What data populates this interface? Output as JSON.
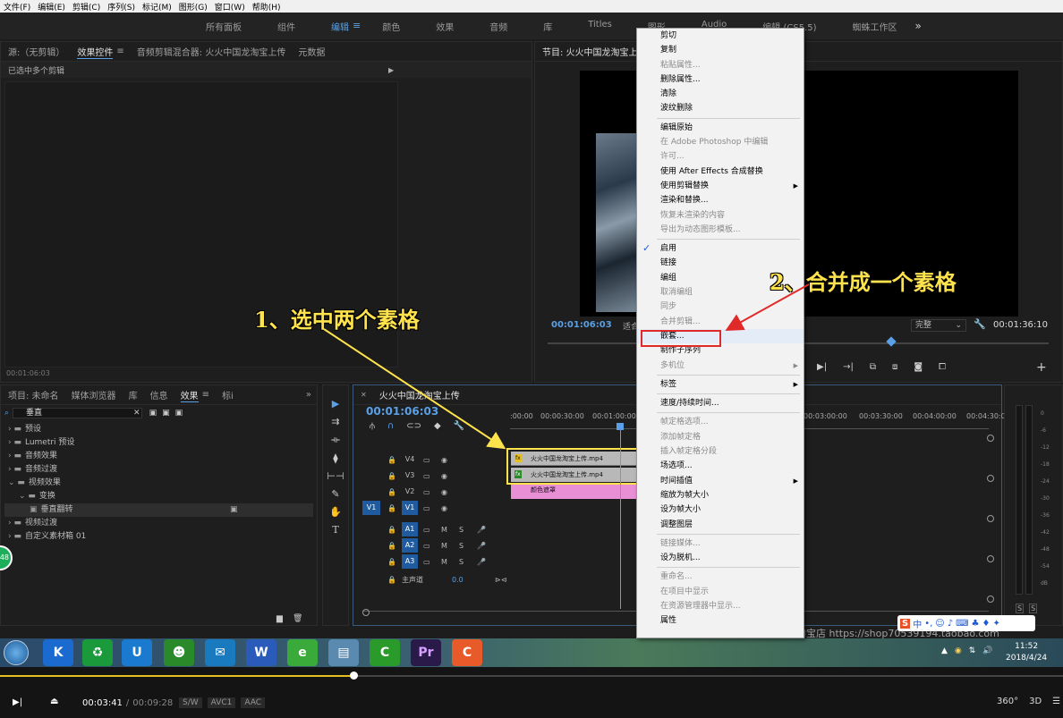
{
  "menubar": [
    "文件(F)",
    "编辑(E)",
    "剪辑(C)",
    "序列(S)",
    "标记(M)",
    "图形(G)",
    "窗口(W)",
    "帮助(H)"
  ],
  "workspaces": [
    "所有面板",
    "组件",
    "编辑",
    "颜色",
    "效果",
    "音频",
    "库",
    "Titles",
    "图形",
    "Audio",
    "编辑 (CS5.5)",
    "蜘蛛工作区"
  ],
  "workspace_active": "编辑",
  "source_panel": {
    "tabs": [
      "源:（无剪辑）",
      "效果控件",
      "音频剪辑混合器: 火火中国龙淘宝上传",
      "元数据"
    ],
    "active_tab": "效果控件",
    "subtitle": "已选中多个剪辑",
    "timecode": "00:01:06:03"
  },
  "program_monitor": {
    "title": "节目: 火火中国龙淘宝上",
    "timecode_left": "00:01:06:03",
    "fit_label": "适合",
    "quality": "完整",
    "timecode_right": "00:01:36:10"
  },
  "project_panel": {
    "tabs": [
      "项目: 未命名",
      "媒体浏览器",
      "库",
      "信息",
      "效果",
      "标i"
    ],
    "active_tab": "效果",
    "search_value": "垂直",
    "tree": [
      {
        "label": "预设",
        "level": 0,
        "type": "folder"
      },
      {
        "label": "Lumetri 预设",
        "level": 0,
        "type": "folder"
      },
      {
        "label": "音频效果",
        "level": 0,
        "type": "folder"
      },
      {
        "label": "音频过渡",
        "level": 0,
        "type": "folder"
      },
      {
        "label": "视频效果",
        "level": 0,
        "type": "folder-open"
      },
      {
        "label": "变换",
        "level": 1,
        "type": "folder-open"
      },
      {
        "label": "垂直翻转",
        "level": 2,
        "type": "effect"
      },
      {
        "label": "视频过渡",
        "level": 0,
        "type": "folder"
      },
      {
        "label": "自定义素材箱 01",
        "level": 0,
        "type": "folder"
      }
    ]
  },
  "timeline": {
    "sequence_name": "火火中国龙淘宝上传",
    "timecode": "00:01:06:03",
    "ruler": [
      ":00:00",
      "00:00:30:00",
      "00:01:00:00",
      "00:03:00:00",
      "00:03:30:00",
      "00:04:00:00",
      "00:04:30:00"
    ],
    "video_tracks": [
      "V4",
      "V3",
      "V2",
      "V1"
    ],
    "audio_tracks": [
      "A1",
      "A2",
      "A3"
    ],
    "master_label": "主声道",
    "master_value": "0.0",
    "source_v1": "V1",
    "clips": [
      {
        "label": "火火中国龙淘宝上传.mp4",
        "track": "V4"
      },
      {
        "label": "火火中国龙淘宝上传.mp4",
        "track": "V3"
      },
      {
        "label": "颜色遮罩",
        "track": "V2"
      }
    ]
  },
  "context_menu": {
    "items": [
      {
        "label": "剪切",
        "enabled": true
      },
      {
        "label": "复制",
        "enabled": true
      },
      {
        "label": "粘贴属性...",
        "enabled": false
      },
      {
        "label": "删除属性...",
        "enabled": true
      },
      {
        "label": "清除",
        "enabled": true
      },
      {
        "label": "波纹删除",
        "enabled": true
      },
      {
        "sep": true
      },
      {
        "label": "编辑原始",
        "enabled": true
      },
      {
        "label": "在 Adobe Photoshop 中编辑",
        "enabled": false
      },
      {
        "label": "许可...",
        "enabled": false
      },
      {
        "label": "使用 After Effects 合成替换",
        "enabled": true
      },
      {
        "label": "使用剪辑替换",
        "enabled": true,
        "submenu": true
      },
      {
        "label": "渲染和替换...",
        "enabled": true
      },
      {
        "label": "恢复未渲染的内容",
        "enabled": false
      },
      {
        "label": "导出为动态图形模板...",
        "enabled": false
      },
      {
        "sep": true
      },
      {
        "label": "启用",
        "enabled": true,
        "checked": true
      },
      {
        "label": "链接",
        "enabled": true
      },
      {
        "label": "编组",
        "enabled": true
      },
      {
        "label": "取消编组",
        "enabled": false
      },
      {
        "label": "同步",
        "enabled": false
      },
      {
        "label": "合并剪辑...",
        "enabled": false
      },
      {
        "label": "嵌套...",
        "enabled": true,
        "highlighted": true
      },
      {
        "label": "制作子序列",
        "enabled": true
      },
      {
        "label": "多机位",
        "enabled": false,
        "submenu": true
      },
      {
        "sep": true
      },
      {
        "label": "标签",
        "enabled": true,
        "submenu": true
      },
      {
        "sep": true
      },
      {
        "label": "速度/持续时间...",
        "enabled": true
      },
      {
        "sep": true
      },
      {
        "label": "帧定格选项...",
        "enabled": false
      },
      {
        "label": "添加帧定格",
        "enabled": false
      },
      {
        "label": "插入帧定格分段",
        "enabled": false
      },
      {
        "label": "场选项...",
        "enabled": true
      },
      {
        "label": "时间插值",
        "enabled": true,
        "submenu": true
      },
      {
        "label": "缩放为帧大小",
        "enabled": true
      },
      {
        "label": "设为帧大小",
        "enabled": true
      },
      {
        "label": "调整图层",
        "enabled": true
      },
      {
        "sep": true
      },
      {
        "label": "链接媒体...",
        "enabled": false
      },
      {
        "label": "设为脱机...",
        "enabled": true
      },
      {
        "sep": true
      },
      {
        "label": "重命名...",
        "enabled": false
      },
      {
        "label": "在项目中显示",
        "enabled": false
      },
      {
        "label": "在资源管理器中显示...",
        "enabled": false
      },
      {
        "label": "属性",
        "enabled": true
      }
    ]
  },
  "annotations": {
    "step1": "1、选中两个素格",
    "step2": "2、合并成一个素格"
  },
  "audio_meter": [
    "0",
    "-6",
    "-12",
    "-18",
    "-24",
    "-30",
    "-36",
    "-42",
    "-48",
    "-54",
    "dB"
  ],
  "audio_meter_solo": [
    "S",
    "S"
  ],
  "taskbar": {
    "clock": "11:52",
    "date": "2018/4/24",
    "watermark": "剪辑淘宝店 https://shop70539194.taobao.com"
  },
  "player": {
    "current": "00:03:41",
    "separator": "/",
    "total": "00:09:28",
    "tags": [
      "S/W",
      "AVC1",
      "AAC"
    ],
    "right_icons": [
      "360°",
      "3D",
      "☰"
    ]
  },
  "colors": {
    "accent_blue": "#5aa0e6",
    "highlight_yellow": "#ffe34d",
    "annotation_red": "#e02a2a",
    "clip_pink": "#e88fd6"
  }
}
